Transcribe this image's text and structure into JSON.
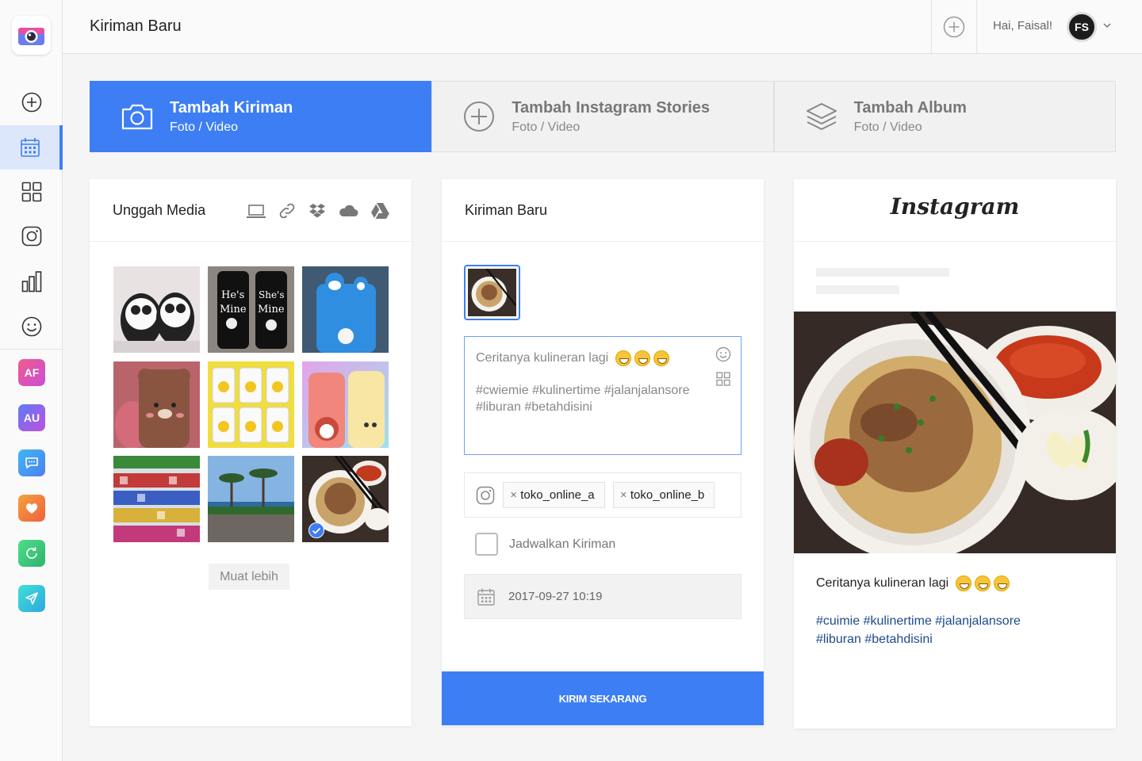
{
  "header": {
    "page_title": "Kiriman Baru",
    "greeting": "Hai, Faisal!",
    "avatar_initials": "FS"
  },
  "sidebar": {
    "items": [
      {
        "icon": "add-circle-icon"
      },
      {
        "icon": "calendar-icon",
        "active": true
      },
      {
        "icon": "grid-icon"
      },
      {
        "icon": "instagram-icon"
      },
      {
        "icon": "bar-chart-icon"
      },
      {
        "icon": "smiley-icon"
      }
    ],
    "apps": [
      {
        "label": "AF",
        "color": "#e8509a"
      },
      {
        "label": "AU",
        "color": "#8a5cf0"
      },
      {
        "label": "",
        "icon": "chat-icon",
        "color": "#3d9cf5"
      },
      {
        "label": "",
        "icon": "heart-icon",
        "color": "#f57a3d"
      },
      {
        "label": "",
        "icon": "refresh-icon",
        "color": "#3dcf7a"
      },
      {
        "label": "",
        "icon": "send-icon",
        "color": "#2ec4e0"
      }
    ]
  },
  "tabs": [
    {
      "title": "Tambah Kiriman",
      "subtitle": "Foto / Video",
      "icon": "camera-icon",
      "active": true
    },
    {
      "title": "Tambah Instagram Stories",
      "subtitle": "Foto / Video",
      "icon": "add-circle-icon",
      "active": false
    },
    {
      "title": "Tambah Album",
      "subtitle": "Foto / Video",
      "icon": "layers-icon",
      "active": false
    }
  ],
  "upload": {
    "title": "Unggah Media",
    "sources": [
      "laptop-icon",
      "link-icon",
      "dropbox-icon",
      "cloud-icon",
      "google-drive-icon"
    ],
    "media": [
      {
        "kind": "panda-case"
      },
      {
        "kind": "hes-mine-case"
      },
      {
        "kind": "doraemon-case"
      },
      {
        "kind": "bear-case"
      },
      {
        "kind": "minions-case"
      },
      {
        "kind": "cute-cases"
      },
      {
        "kind": "shelf-cases"
      },
      {
        "kind": "beach-palms"
      },
      {
        "kind": "noodle-bowl",
        "selected": true
      }
    ],
    "load_more": "Muat lebih"
  },
  "composer": {
    "title": "Kiriman Baru",
    "caption_line": "Ceritanya kulineran lagi",
    "caption_tags": "#cwiemie #kulinertime #jalanjalansore #liburan #betahdisini",
    "accounts": [
      "toko_online_a",
      "toko_online_b"
    ],
    "schedule_label": "Jadwalkan Kiriman",
    "schedule_date": "2017-09-27 10:19",
    "send_label": "KIRIM SEKARANG"
  },
  "preview": {
    "brand": "Instagram",
    "caption_line": "Ceritanya kulineran lagi",
    "caption_tags": "#cuimie #kulinertime #jalanjalansore #liburan #betahdisini"
  }
}
